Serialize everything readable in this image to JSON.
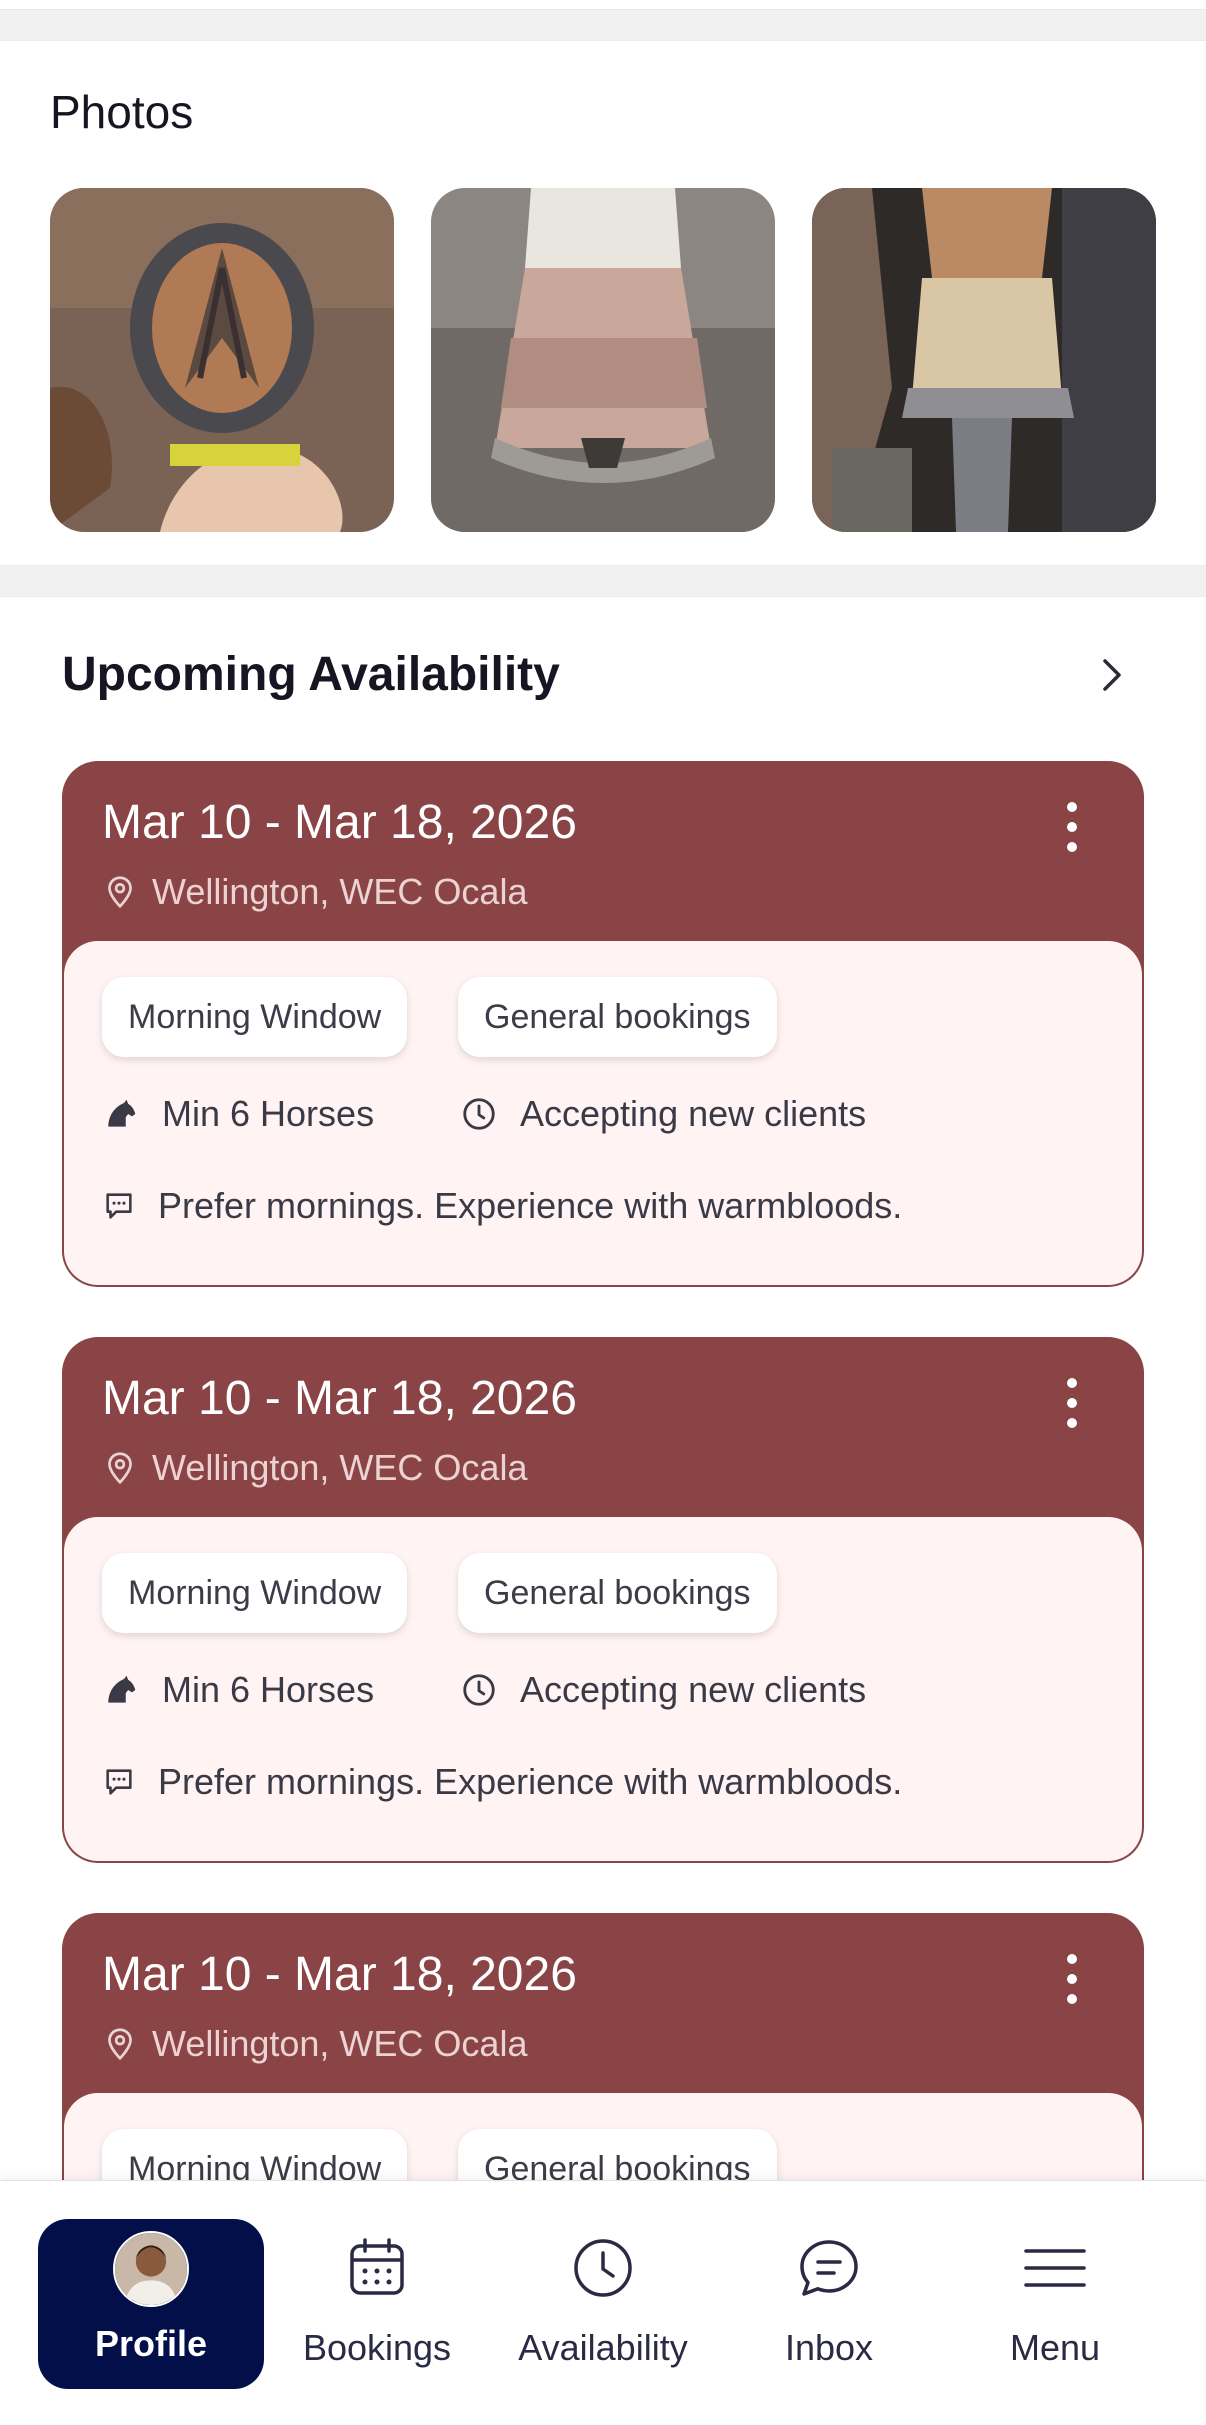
{
  "photos": {
    "title": "Photos",
    "items": [
      {
        "label": "hoof-underside-photo"
      },
      {
        "label": "hoof-front-photo"
      },
      {
        "label": "hoof-shoeing-photo"
      }
    ]
  },
  "availability": {
    "title": "Upcoming Availability",
    "cards": [
      {
        "date_range": "Mar 10 - Mar 18, 2026",
        "location": "Wellington, WEC Ocala",
        "chips": [
          "Morning Window",
          "General bookings"
        ],
        "min_horses": "Min 6 Horses",
        "client_status": "Accepting new clients",
        "note": "Prefer mornings. Experience with warmbloods."
      },
      {
        "date_range": "Mar 10 - Mar 18, 2026",
        "location": "Wellington, WEC Ocala",
        "chips": [
          "Morning Window",
          "General bookings"
        ],
        "min_horses": "Min 6 Horses",
        "client_status": "Accepting new clients",
        "note": "Prefer mornings. Experience with warmbloods."
      },
      {
        "date_range": "Mar 10 - Mar 18, 2026",
        "location": "Wellington, WEC Ocala",
        "chips": [
          "Morning Window",
          "General bookings"
        ]
      }
    ]
  },
  "nav": {
    "items": [
      {
        "label": "Profile",
        "icon": "avatar",
        "active": true
      },
      {
        "label": "Bookings",
        "icon": "calendar-icon"
      },
      {
        "label": "Availability",
        "icon": "clock-icon"
      },
      {
        "label": "Inbox",
        "icon": "chat-bubble-icon"
      },
      {
        "label": "Menu",
        "icon": "hamburger-icon"
      }
    ]
  },
  "colors": {
    "card_header": "#8a4445",
    "card_body": "#fff3f3",
    "nav_active": "#030f48"
  }
}
